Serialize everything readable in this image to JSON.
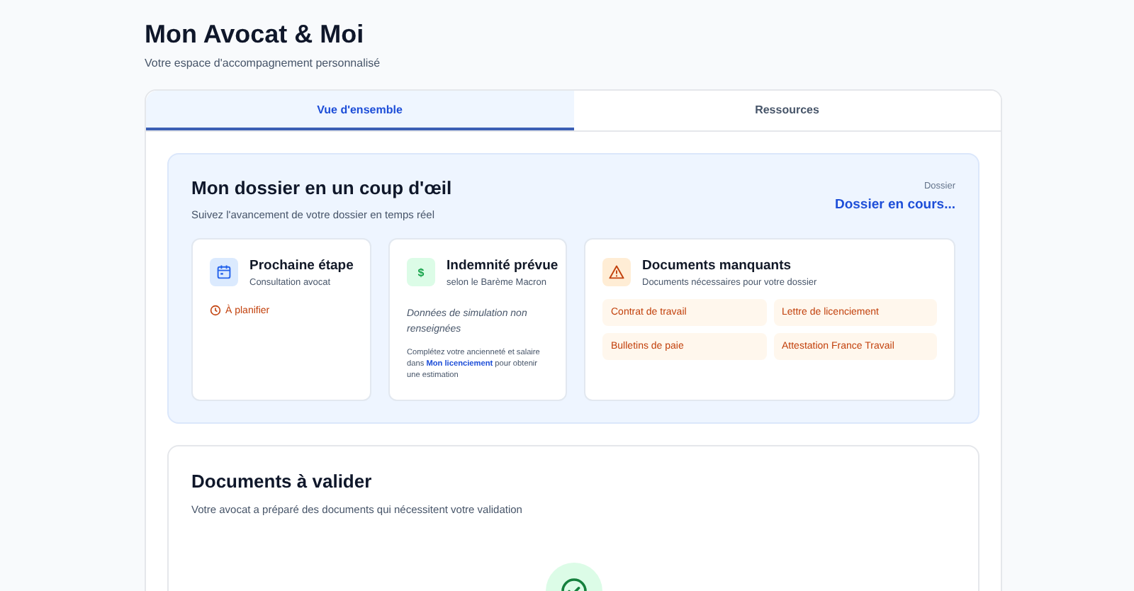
{
  "header": {
    "title": "Mon Avocat & Moi",
    "subtitle": "Votre espace d'accompagnement personnalisé"
  },
  "tabs": [
    {
      "label": "Vue d'ensemble",
      "selected": true
    },
    {
      "label": "Ressources",
      "selected": false
    }
  ],
  "overview": {
    "title": "Mon dossier en un coup d'œil",
    "subtitle": "Suivez l'avancement de votre dossier en temps réel",
    "dossier_label": "Dossier",
    "dossier_status": "Dossier en cours...",
    "cards": [
      {
        "kind": "step",
        "title": "Prochaine étape",
        "subtitle": "Consultation avocat",
        "status": "À planifier"
      },
      {
        "kind": "indemnity",
        "title": "Indemnité prévue",
        "subtitle": "selon le Barème Macron",
        "icon_text": "$",
        "note": "Données de simulation non renseignées",
        "hint_before": "Complétez votre ancienneté et salaire dans",
        "hint_link": "Mon licenciement",
        "hint_after": "pour obtenir une estimation"
      },
      {
        "kind": "missing",
        "title": "Documents manquants",
        "subtitle": "Documents nécessaires pour votre dossier",
        "documents": [
          "Contrat de travail",
          "Lettre de licenciement",
          "Bulletins de paie",
          "Attestation France Travail"
        ]
      }
    ]
  },
  "validation": {
    "title": "Documents à valider",
    "subtitle": "Votre avocat a préparé des documents qui nécessitent votre validation"
  }
}
